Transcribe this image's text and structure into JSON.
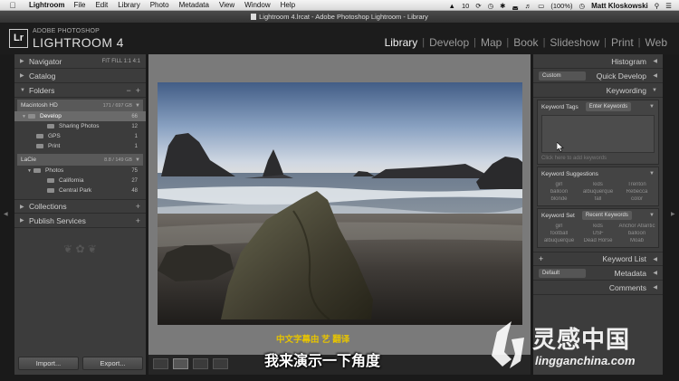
{
  "menubar": {
    "app": "Lightroom",
    "items": [
      "File",
      "Edit",
      "Library",
      "Photo",
      "Metadata",
      "View",
      "Window",
      "Help"
    ],
    "status_text": "10",
    "battery": "(100%)",
    "user": "Matt Kloskowski"
  },
  "window": {
    "title": "Lightroom 4.lrcat - Adobe Photoshop Lightroom - Library"
  },
  "brand": {
    "badge": "Lr",
    "top": "ADOBE PHOTOSHOP",
    "main": "LIGHTROOM 4"
  },
  "modules": [
    "Library",
    "Develop",
    "Map",
    "Book",
    "Slideshow",
    "Print",
    "Web"
  ],
  "left_panel": {
    "navigator": {
      "label": "Navigator",
      "zoom": "FIT  FILL  1:1  4:1"
    },
    "catalog": {
      "label": "Catalog"
    },
    "folders": {
      "label": "Folders",
      "volume1": {
        "name": "Macintosh HD",
        "size": "171 / 697 GB"
      },
      "rows1": [
        {
          "name": "Develop",
          "count": "66"
        },
        {
          "name": "Sharing Photos",
          "count": "12"
        },
        {
          "name": "GPS",
          "count": "1"
        },
        {
          "name": "Print",
          "count": "1"
        }
      ],
      "volume2": {
        "name": "LaCie",
        "size": "8.8 / 149 GB"
      },
      "rows2": [
        {
          "name": "Photos",
          "count": "75"
        },
        {
          "name": "California",
          "count": "27"
        },
        {
          "name": "Central Park",
          "count": "48"
        }
      ]
    },
    "collections": {
      "label": "Collections"
    },
    "publish": {
      "label": "Publish Services"
    },
    "import_label": "Import...",
    "export_label": "Export..."
  },
  "right_panel": {
    "histogram": "Histogram",
    "quick_develop": {
      "label": "Quick Develop",
      "preset": "Custom"
    },
    "keywording": {
      "label": "Keywording",
      "tags_label": "Keyword Tags",
      "tags_select": "Enter Keywords",
      "add_hint": "Click here to add keywords",
      "suggestions_label": "Keyword Suggestions",
      "suggestions": [
        "girl",
        "kids",
        "Trenton",
        "balloon",
        "albuquerque",
        "Rebecca",
        "blonde",
        "fall",
        "color"
      ],
      "set_label": "Keyword Set",
      "set_select": "Recent Keywords",
      "set_items": [
        "girl",
        "kids",
        "Anchor Atlantic",
        "football",
        "USF",
        "balloon",
        "albuquerque",
        "Dead Horse",
        "Moab"
      ]
    },
    "keyword_list": "Keyword List",
    "metadata": {
      "label": "Metadata",
      "preset": "Default"
    },
    "comments": "Comments"
  },
  "subtitles": {
    "credit": "中文字幕由  艺  翻译",
    "main": "我来演示一下角度"
  },
  "watermark": {
    "cn": "灵感中国",
    "url": "lingganchina.com"
  }
}
